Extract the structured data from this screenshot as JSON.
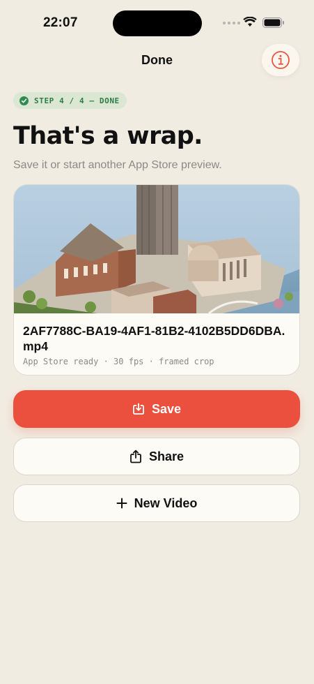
{
  "status_bar": {
    "time": "22:07"
  },
  "nav": {
    "title": "Done"
  },
  "step_badge": {
    "label": "STEP 4 / 4 — DONE"
  },
  "header": {
    "headline": "That's a wrap.",
    "subtitle": "Save it or start another App Store preview."
  },
  "file_card": {
    "file_name": "2AF7788C-BA19-4AF1-81B2-4102B5DD6DBA.mp4",
    "meta": "App Store ready · 30 fps · framed crop"
  },
  "actions": {
    "save_label": "Save",
    "share_label": "Share",
    "new_video_label": "New Video"
  },
  "icons": {
    "info": "info-icon",
    "check": "check-icon",
    "save": "save-icon",
    "share": "share-icon",
    "plus": "plus-icon"
  },
  "colors": {
    "background": "#f1ece2",
    "accent": "#ea503d",
    "success": "#2e8a4e",
    "badge_bg": "#dbe6d3"
  }
}
